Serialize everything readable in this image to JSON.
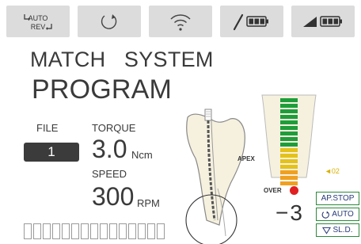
{
  "toolbar": {
    "auto_rev": {
      "line1": "AUTO",
      "line2": "REV",
      "icon": "auto-reverse-icon"
    },
    "rotate": {
      "icon": "rotation-icon"
    },
    "wireless": {
      "icon": "wireless-icon"
    },
    "handpiece": {
      "icon": "handpiece-battery-icon"
    },
    "apex": {
      "icon": "apex-locator-battery-icon"
    }
  },
  "title": {
    "line1": "MATCH   SYSTEM",
    "line2": "PROGRAM"
  },
  "file": {
    "label": "FILE",
    "value": "1"
  },
  "torque": {
    "label": "TORQUE",
    "value": "3.0",
    "unit": "Ncm"
  },
  "speed": {
    "label": "SPEED",
    "value": "300",
    "unit": "RPM"
  },
  "apex_locator": {
    "apex_label": "APEX",
    "over_label": "OVER",
    "marker_label": "◄02",
    "distance": "−3",
    "bar_levels": {
      "green": 9,
      "yellow": 4,
      "orange": 4
    },
    "colors": {
      "green": "#1e9e3a",
      "yellow": "#e4c21a",
      "orange": "#f0a020",
      "over": "#e02020"
    }
  },
  "status": {
    "apstop": "AP.STOP",
    "auto": "AUTO",
    "sld": "SL.D."
  },
  "progress": {
    "segments": 15,
    "filled": 0
  }
}
